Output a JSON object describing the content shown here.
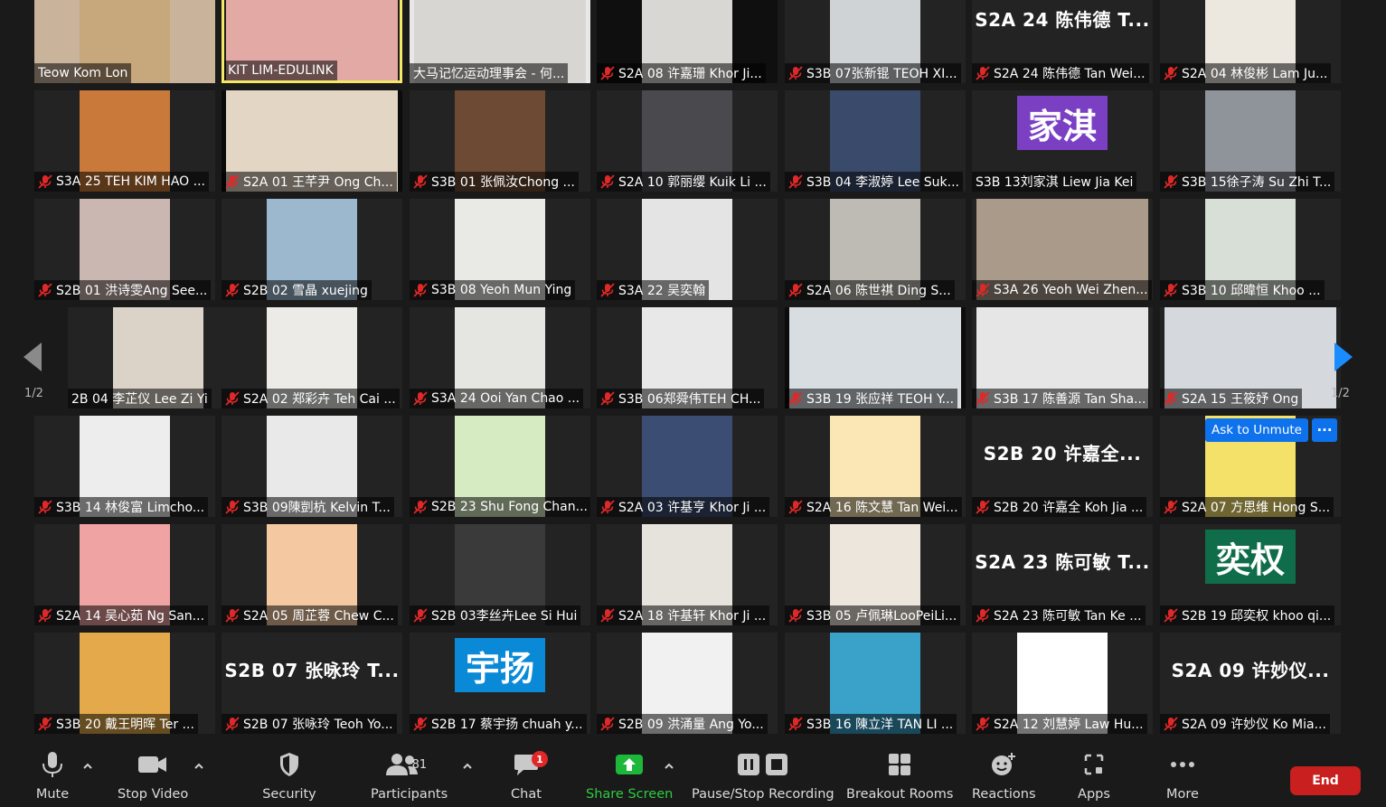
{
  "colors": {
    "accent_blue": "#0e72ed",
    "active_speaker_border": "#f5e866",
    "mute_red": "#e02828",
    "share_green": "#2ecc40",
    "end_red": "#c91f1f"
  },
  "gallery": {
    "page_left": "1/2",
    "page_right": "1/2",
    "tiles": [
      {
        "name": "Teow Kom Lon",
        "muted": false,
        "bg": "#c9b39b",
        "video": "#c7a77c"
      },
      {
        "name": "KIT LIM-EDULINK",
        "muted": false,
        "active": true,
        "bg": "#1f1f1f",
        "video": "#e3a9a4",
        "video_wide": true
      },
      {
        "name": "大马记忆运动理事会 - 何...",
        "muted": false,
        "bg": "#e8e8e8",
        "video": "#d8d6d2",
        "video_wide": true
      },
      {
        "name": "S2A 08 许嘉珊 Khor Ji...",
        "muted": true,
        "bg": "#0f0f0f",
        "video": "#d9d7d3"
      },
      {
        "name": "S3B 07张新锟 TEOH XI...",
        "muted": true,
        "bg": "#232323",
        "video": "#cfd3d6"
      },
      {
        "name": "S2A 24 陈伟德 Tan Wei...",
        "muted": true,
        "bg": "#232323",
        "banner": "S2A 24 陈伟德 T..."
      },
      {
        "name": "S2A 04 林俊彬 Lam Ju...",
        "muted": true,
        "bg": "#232323",
        "video": "#ece7df"
      },
      {
        "name": "S3A 25 TEH KIM HAO ...",
        "muted": true,
        "bg": "#232323",
        "video": "#c97a3a"
      },
      {
        "name": "S2A 01 王芊尹 Ong Ch...",
        "muted": true,
        "bg": "#0b0b0b",
        "video": "#e3d6c4",
        "video_wide": true
      },
      {
        "name": "S3B 01 张佩汝Chong ...",
        "muted": true,
        "bg": "#232323",
        "video": "#6d4a33"
      },
      {
        "name": "S2A 10 郭丽缨 Kuik Li ...",
        "muted": true,
        "bg": "#232323",
        "video": "#4a4a4e"
      },
      {
        "name": "S3B 04 李淑婷 Lee Suk...",
        "muted": true,
        "bg": "#232323",
        "video": "#3a4a6a"
      },
      {
        "name": "S3B 13刘家淇 Liew Jia Kei",
        "muted": false,
        "bg": "#232323",
        "avatar": "家淇",
        "avatar_color": "#7b3fc4"
      },
      {
        "name": "S3B 15徐子涛 Su Zhi T...",
        "muted": true,
        "bg": "#232323",
        "video": "#8f939a"
      },
      {
        "name": "S2B 01 洪诗雯Ang See...",
        "muted": true,
        "bg": "#232323",
        "video": "#cbb7b2"
      },
      {
        "name": "S2B 02 雪晶 xuejing",
        "muted": true,
        "bg": "#232323",
        "video": "#9bb8cf"
      },
      {
        "name": "S3B 08 Yeoh Mun Ying",
        "muted": true,
        "bg": "#232323",
        "video": "#e9e9e6"
      },
      {
        "name": "S3A 22 吴奕翰",
        "muted": true,
        "bg": "#232323",
        "video": "#e4e4e4"
      },
      {
        "name": "S2A 06 陈世祺 Ding S...",
        "muted": true,
        "bg": "#232323",
        "video": "#bdbbb4"
      },
      {
        "name": "S3A 26 Yeoh Wei Zhen...",
        "muted": true,
        "bg": "#232323",
        "video": "#a99a8a",
        "video_wide": true
      },
      {
        "name": "S3B 10 邱暐恒 Khoo ...",
        "muted": true,
        "bg": "#232323",
        "video": "#d7dfd6"
      },
      {
        "name": "2B 04 李芷仪 Lee Zi Yi",
        "muted": false,
        "bg": "#232323",
        "video": "#dcd3c8"
      },
      {
        "name": "S2A 02 郑彩卉 Teh Cai ...",
        "muted": true,
        "bg": "#232323",
        "video": "#ecebe8"
      },
      {
        "name": "S3A 24 Ooi Yan Chao ...",
        "muted": true,
        "bg": "#232323",
        "video": "#e5e5e2"
      },
      {
        "name": "S3B 06郑舜伟TEH CH...",
        "muted": true,
        "bg": "#232323",
        "video": "#e8e8e8"
      },
      {
        "name": "S3B 19 张应祥 TEOH Y...",
        "muted": true,
        "bg": "#0c0c0c",
        "video": "#d8dde2",
        "video_wide": true
      },
      {
        "name": "S3B 17 陈善源 Tan Sha...",
        "muted": true,
        "bg": "#232323",
        "video": "#e6e6e6",
        "video_wide": true
      },
      {
        "name": "S2A 15 王筱妤 Ong",
        "muted": true,
        "bg": "#232323",
        "video": "#d5d8dc",
        "video_wide": true
      },
      {
        "name": "S3B 14 林俊富 Limcho...",
        "muted": true,
        "bg": "#232323",
        "video": "#ededed"
      },
      {
        "name": "S3B 09陳剴杭 Kelvin T...",
        "muted": true,
        "bg": "#232323",
        "video": "#e9e9e9"
      },
      {
        "name": "S2B 23 Shu Fong Chan...",
        "muted": true,
        "bg": "#232323",
        "video": "#d6ebc2"
      },
      {
        "name": "S2A 03 许基亨 Khor Ji ...",
        "muted": true,
        "bg": "#232323",
        "video": "#3b4d72"
      },
      {
        "name": "S2A 16 陈文慧 Tan Wei...",
        "muted": true,
        "bg": "#232323",
        "video": "#fbe7b5"
      },
      {
        "name": "S2B 20 许嘉全 Koh Jia ...",
        "muted": true,
        "bg": "#232323",
        "banner": "S2B 20 许嘉全..."
      },
      {
        "name": "S2A 07 方思维 Hong S...",
        "muted": true,
        "bg": "#232323",
        "video": "#f4e16a"
      },
      {
        "name": "S2A 14 吴心茹 Ng San...",
        "muted": true,
        "bg": "#232323",
        "video": "#f0a3a3"
      },
      {
        "name": "S2A 05 周芷蓉 Chew C...",
        "muted": true,
        "bg": "#232323",
        "video": "#f4c8a0"
      },
      {
        "name": "S2B 03李丝卉Lee Si Hui",
        "muted": true,
        "bg": "#232323",
        "video": "#3a3a3a"
      },
      {
        "name": "S2A 18 许基轩 Khor Ji ...",
        "muted": true,
        "bg": "#232323",
        "video": "#e6e2dc"
      },
      {
        "name": "S3B 05 卢佩琳LooPeiLi...",
        "muted": true,
        "bg": "#232323",
        "video": "#ede6dc"
      },
      {
        "name": "S2A 23 陈可敏 Tan Ke ...",
        "muted": true,
        "bg": "#232323",
        "banner": "S2A 23 陈可敏 T..."
      },
      {
        "name": "S2B 19 邱奕权 khoo qi...",
        "muted": true,
        "bg": "#232323",
        "avatar": "奕权",
        "avatar_color": "#0f6d4a"
      },
      {
        "name": "S3B 20 戴王明晖 Ter ...",
        "muted": true,
        "bg": "#232323",
        "video": "#e3a94a"
      },
      {
        "name": "S2B 07 张咏玲 Teoh Yo...",
        "muted": true,
        "bg": "#232323",
        "banner": "S2B 07 张咏玲 T..."
      },
      {
        "name": "S2B 17 蔡宇扬 chuah y...",
        "muted": true,
        "bg": "#232323",
        "avatar": "宇扬",
        "avatar_color": "#0a8ad6"
      },
      {
        "name": "S2B 09 洪涌量 Ang Yo...",
        "muted": true,
        "bg": "#232323",
        "video": "#f1f1f1"
      },
      {
        "name": "S3B 16 陳立洋 TAN LI ...",
        "muted": true,
        "bg": "#232323",
        "video": "#3aa1c9"
      },
      {
        "name": "S2A 12 刘慧婷 Law Hu...",
        "muted": true,
        "bg": "#232323",
        "video": "#ffffff"
      },
      {
        "name": "S2A 09 许妙仪 Ko Mia...",
        "muted": true,
        "bg": "#232323",
        "banner": "S2A 09 许妙仪..."
      }
    ]
  },
  "ask_to_unmute": {
    "label": "Ask to Unmute",
    "more": "···"
  },
  "toolbar": {
    "mute": "Mute",
    "stop_video": "Stop Video",
    "security": "Security",
    "participants": "Participants",
    "participants_count": "81",
    "chat": "Chat",
    "chat_badge": "1",
    "share_screen": "Share Screen",
    "recording": "Pause/Stop Recording",
    "breakout": "Breakout Rooms",
    "reactions": "Reactions",
    "apps": "Apps",
    "more": "More",
    "end": "End"
  }
}
